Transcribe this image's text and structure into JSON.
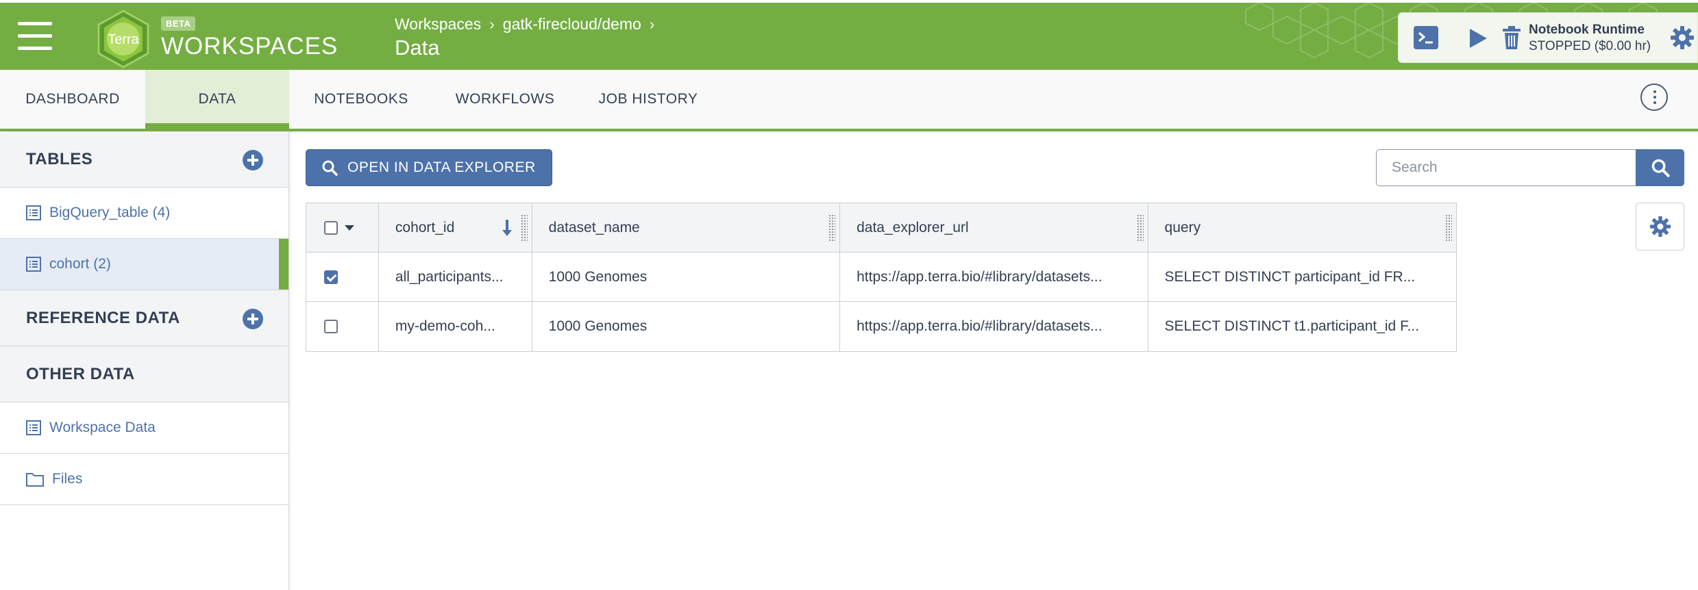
{
  "header": {
    "logo_text": "Terra",
    "beta_badge": "BETA",
    "product_name": "WORKSPACES",
    "breadcrumb": [
      "Workspaces",
      "gatk-firecloud/demo"
    ],
    "breadcrumb_separator": "›",
    "page_title": "Data",
    "runtime": {
      "title": "Notebook Runtime",
      "status": "STOPPED ($0.00 hr)"
    }
  },
  "tabs": [
    {
      "label": "DASHBOARD",
      "active": false
    },
    {
      "label": "DATA",
      "active": true
    },
    {
      "label": "NOTEBOOKS",
      "active": false
    },
    {
      "label": "WORKFLOWS",
      "active": false
    },
    {
      "label": "JOB HISTORY",
      "active": false
    }
  ],
  "sidebar": {
    "tables_heading": "TABLES",
    "tables": [
      {
        "label": "BigQuery_table (4)",
        "selected": false
      },
      {
        "label": "cohort (2)",
        "selected": true
      }
    ],
    "reference_heading": "REFERENCE DATA",
    "other_heading": "OTHER DATA",
    "other_items": [
      {
        "label": "Workspace Data",
        "icon": "list-icon"
      },
      {
        "label": "Files",
        "icon": "folder-icon"
      }
    ]
  },
  "main": {
    "explorer_button": "OPEN IN DATA EXPLORER",
    "search_placeholder": "Search",
    "table": {
      "columns": [
        "cohort_id",
        "dataset_name",
        "data_explorer_url",
        "query"
      ],
      "rows": [
        {
          "checked": true,
          "cells": [
            "all_participants...",
            "1000 Genomes",
            "https://app.terra.bio/#library/datasets...",
            "SELECT DISTINCT participant_id FR..."
          ]
        },
        {
          "checked": false,
          "cells": [
            "my-demo-coh...",
            "1000 Genomes",
            "https://app.terra.bio/#library/datasets...",
            "SELECT DISTINCT t1.participant_id F..."
          ]
        }
      ]
    }
  },
  "colors": {
    "brand_green": "#74ae43",
    "accent_blue": "#4d72aa",
    "text_dark": "#333f52"
  }
}
